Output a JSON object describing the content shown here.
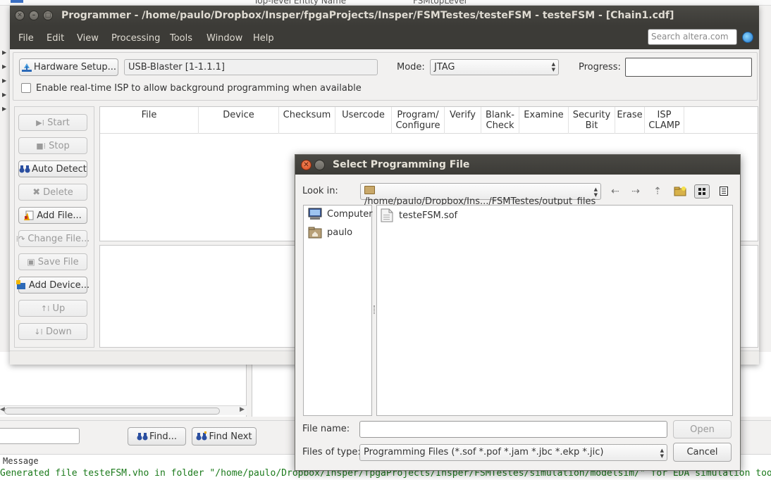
{
  "background": {
    "top_text_left": "Top-level Entity Name",
    "top_text_right": "FSMtopLevel",
    "find_button": "Find...",
    "find_next_button": "Find Next",
    "message_header": "Message",
    "message_line": "Generated file testeFSM.vho in folder \"/home/paulo/Dropbox/Insper/fpgaProjects/Insper/FSMTestes/simulation/modelsim/\" for EDA simulation tool"
  },
  "programmer": {
    "title": "Programmer - /home/paulo/Dropbox/Insper/fpgaProjects/Insper/FSMTestes/testeFSM - testeFSM - [Chain1.cdf]",
    "menu": [
      "File",
      "Edit",
      "View",
      "Processing",
      "Tools",
      "Window",
      "Help"
    ],
    "search_placeholder": "Search altera.com",
    "hardware_setup_label": "Hardware Setup...",
    "hardware_value": "USB-Blaster [1-1.1.1]",
    "mode_label": "Mode:",
    "mode_value": "JTAG",
    "progress_label": "Progress:",
    "isp_label": "Enable real-time ISP to allow background programming when available",
    "side_buttons": {
      "start": "Start",
      "stop": "Stop",
      "auto_detect": "Auto Detect",
      "delete": "Delete",
      "add_file": "Add File...",
      "change_file": "Change File...",
      "save_file": "Save File",
      "add_device": "Add Device...",
      "up": "Up",
      "down": "Down"
    },
    "columns": {
      "file": "File",
      "device": "Device",
      "checksum": "Checksum",
      "usercode": "Usercode",
      "program_1": "Program/",
      "program_2": "Configure",
      "verify": "Verify",
      "blank_1": "Blank-",
      "blank_2": "Check",
      "examine": "Examine",
      "security_1": "Security",
      "security_2": "Bit",
      "erase": "Erase",
      "isp_1": "ISP",
      "isp_2": "CLAMP"
    }
  },
  "dialog": {
    "title": "Select Programming File",
    "look_in_label": "Look in:",
    "look_in_value": "/home/paulo/Dropbox/Ins.../FSMTestes/output_files",
    "places": [
      "Computer",
      "paulo"
    ],
    "files": [
      "testeFSM.sof"
    ],
    "file_name_label": "File name:",
    "file_name_value": "",
    "open_label": "Open",
    "file_type_label": "Files of type:",
    "file_type_value": "Programming Files (*.sof *.pof *.jam *.jbc *.ekp *.jic)",
    "cancel_label": "Cancel"
  }
}
